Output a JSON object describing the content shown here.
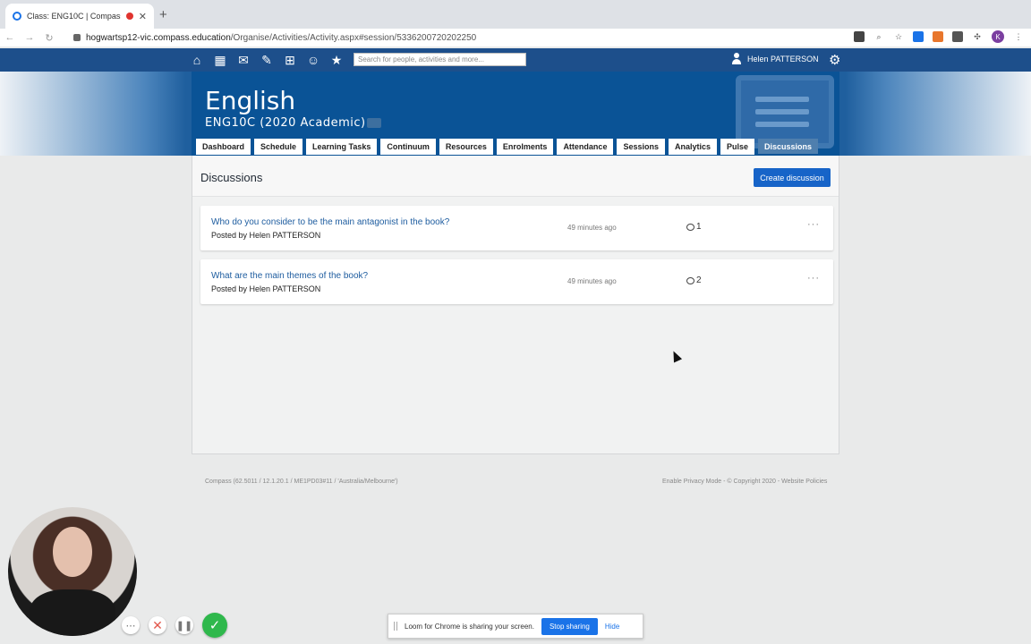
{
  "browser": {
    "tab_title": "Class: ENG10C | Compass",
    "url_host": "hogwartsp12-vic.compass.education",
    "url_path": "/Organise/Activities/Activity.aspx#session/5336200720202250"
  },
  "nav": {
    "search_placeholder": "Search for people, activities and more...",
    "user_name": "Helen PATTERSON"
  },
  "banner": {
    "title": "English",
    "subtitle": "ENG10C (2020 Academic)"
  },
  "tabs": [
    {
      "label": "Dashboard"
    },
    {
      "label": "Schedule"
    },
    {
      "label": "Learning Tasks"
    },
    {
      "label": "Continuum"
    },
    {
      "label": "Resources"
    },
    {
      "label": "Enrolments"
    },
    {
      "label": "Attendance"
    },
    {
      "label": "Sessions"
    },
    {
      "label": "Analytics"
    },
    {
      "label": "Pulse"
    },
    {
      "label": "Discussions",
      "active": true
    }
  ],
  "panel": {
    "title": "Discussions",
    "create_label": "Create discussion"
  },
  "discussions": [
    {
      "title": "Who do you consider to be the main antagonist in the book?",
      "author": "Posted by Helen PATTERSON",
      "time": "49 minutes ago",
      "replies": "1"
    },
    {
      "title": "What are the main themes of the book?",
      "author": "Posted by Helen PATTERSON",
      "time": "49 minutes ago",
      "replies": "2"
    }
  ],
  "footer": {
    "left": "Compass (62.5011 / 12.1.20.1 / ME1PD03#11 / 'Australia/Melbourne')",
    "right": "Enable Privacy Mode - © Copyright 2020 - Website Policies"
  },
  "loom": {
    "share_text": "Loom for Chrome is sharing your screen.",
    "stop_label": "Stop sharing",
    "hide_label": "Hide"
  }
}
